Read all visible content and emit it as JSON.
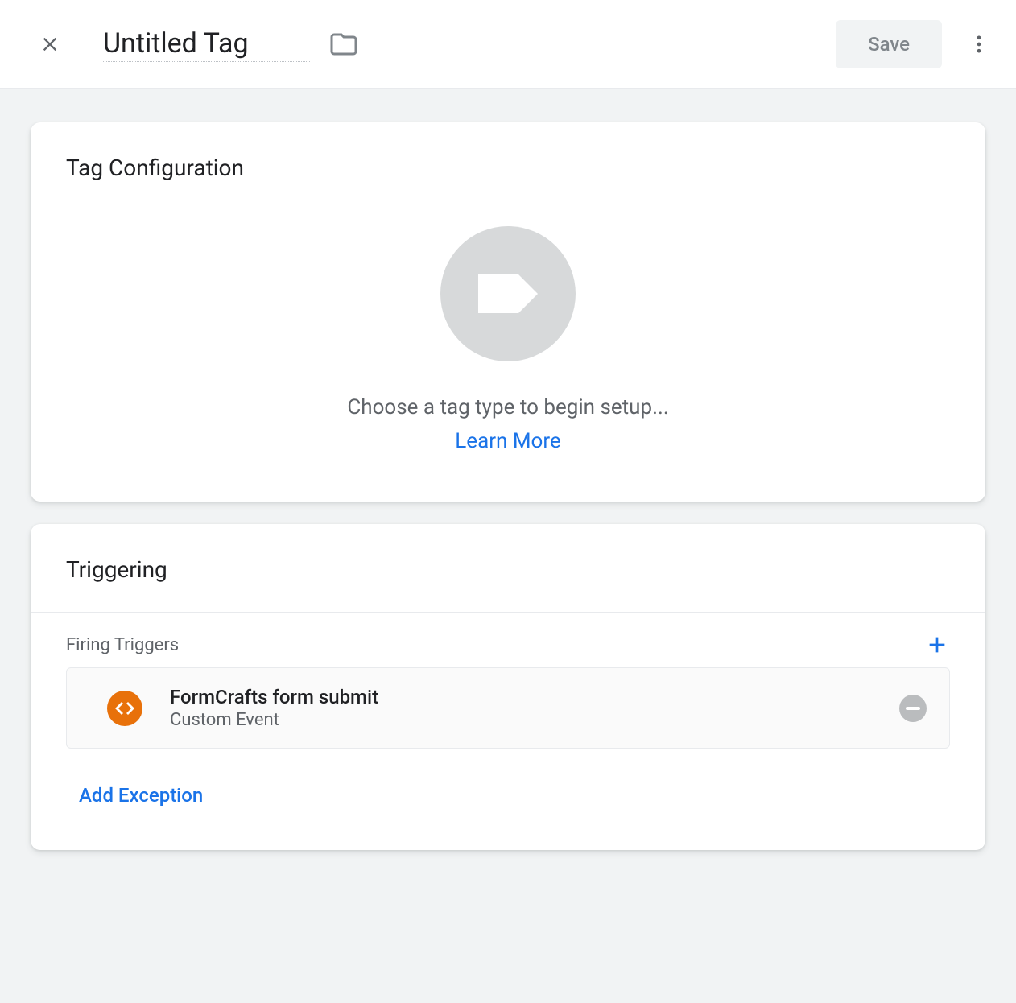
{
  "header": {
    "title": "Untitled Tag",
    "save_label": "Save"
  },
  "tag_config": {
    "title": "Tag Configuration",
    "setup_text": "Choose a tag type to begin setup...",
    "learn_more": "Learn More"
  },
  "triggering": {
    "title": "Triggering",
    "firing_label": "Firing Triggers",
    "triggers": [
      {
        "name": "FormCrafts form submit",
        "type": "Custom Event"
      }
    ],
    "add_exception": "Add Exception"
  }
}
